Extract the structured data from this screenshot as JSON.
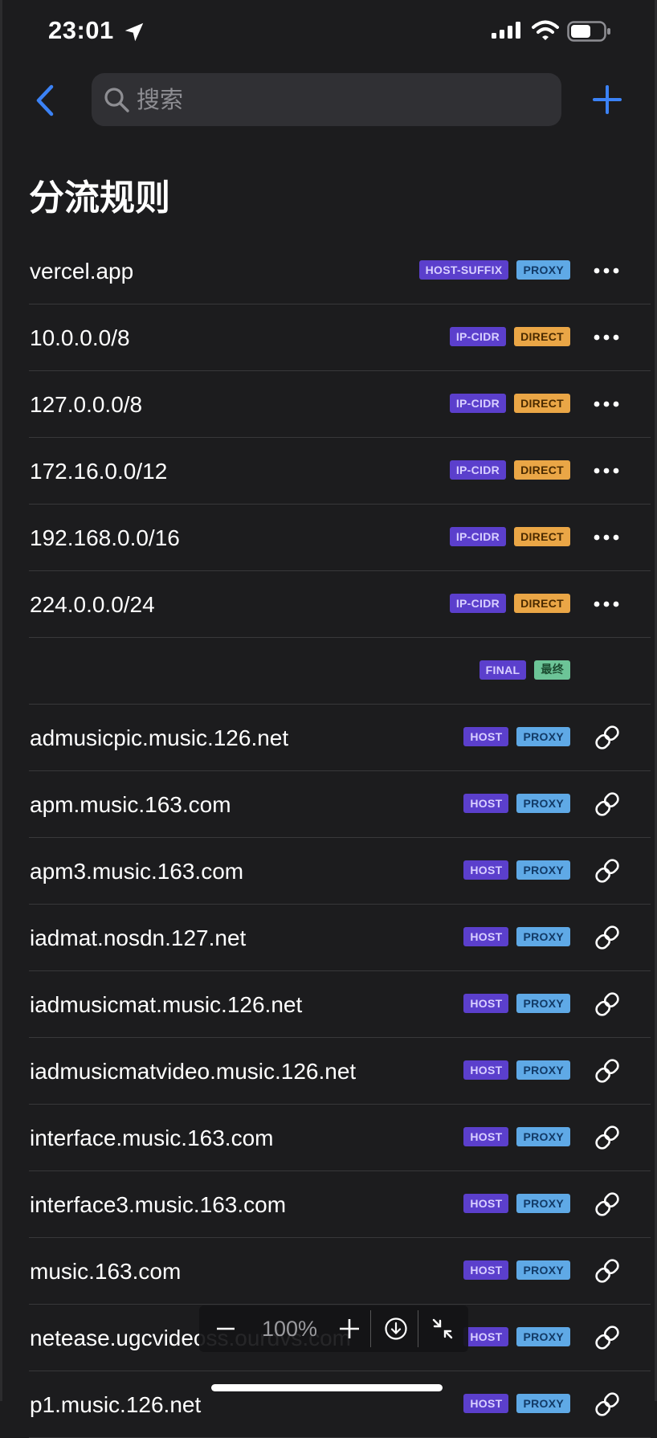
{
  "status_bar": {
    "time": "23:01"
  },
  "nav": {
    "search_placeholder": "搜索"
  },
  "page": {
    "title": "分流规则"
  },
  "colors": {
    "background": "#1c1c1e",
    "accent": "#3b82f6",
    "type_tag": "#5b3fcc",
    "proxy_tag": "#5fa9e6",
    "direct_tag": "#eaa646",
    "final_tag": "#6cc497"
  },
  "rules": [
    {
      "name": "vercel.app",
      "type": "HOST-SUFFIX",
      "policy": "PROXY",
      "action": "more-icon"
    },
    {
      "name": "10.0.0.0/8",
      "type": "IP-CIDR",
      "policy": "DIRECT",
      "action": "more-icon"
    },
    {
      "name": "127.0.0.0/8",
      "type": "IP-CIDR",
      "policy": "DIRECT",
      "action": "more-icon"
    },
    {
      "name": "172.16.0.0/12",
      "type": "IP-CIDR",
      "policy": "DIRECT",
      "action": "more-icon"
    },
    {
      "name": "192.168.0.0/16",
      "type": "IP-CIDR",
      "policy": "DIRECT",
      "action": "more-icon"
    },
    {
      "name": "224.0.0.0/24",
      "type": "IP-CIDR",
      "policy": "DIRECT",
      "action": "more-icon"
    },
    {
      "name": "",
      "type": "FINAL",
      "policy": "最终",
      "action": "none"
    },
    {
      "name": "admusicpic.music.126.net",
      "type": "HOST",
      "policy": "PROXY",
      "action": "link-icon"
    },
    {
      "name": "apm.music.163.com",
      "type": "HOST",
      "policy": "PROXY",
      "action": "link-icon"
    },
    {
      "name": "apm3.music.163.com",
      "type": "HOST",
      "policy": "PROXY",
      "action": "link-icon"
    },
    {
      "name": "iadmat.nosdn.127.net",
      "type": "HOST",
      "policy": "PROXY",
      "action": "link-icon"
    },
    {
      "name": "iadmusicmat.music.126.net",
      "type": "HOST",
      "policy": "PROXY",
      "action": "link-icon"
    },
    {
      "name": "iadmusicmatvideo.music.126.net",
      "type": "HOST",
      "policy": "PROXY",
      "action": "link-icon"
    },
    {
      "name": "interface.music.163.com",
      "type": "HOST",
      "policy": "PROXY",
      "action": "link-icon"
    },
    {
      "name": "interface3.music.163.com",
      "type": "HOST",
      "policy": "PROXY",
      "action": "link-icon"
    },
    {
      "name": "music.163.com",
      "type": "HOST",
      "policy": "PROXY",
      "action": "link-icon"
    },
    {
      "name": "netease.ugcvideoss.ourdvs.com",
      "type": "HOST",
      "policy": "PROXY",
      "action": "link-icon"
    },
    {
      "name": "p1.music.126.net",
      "type": "HOST",
      "policy": "PROXY",
      "action": "link-icon"
    }
  ],
  "zoom_toolbar": {
    "value": "100%"
  }
}
